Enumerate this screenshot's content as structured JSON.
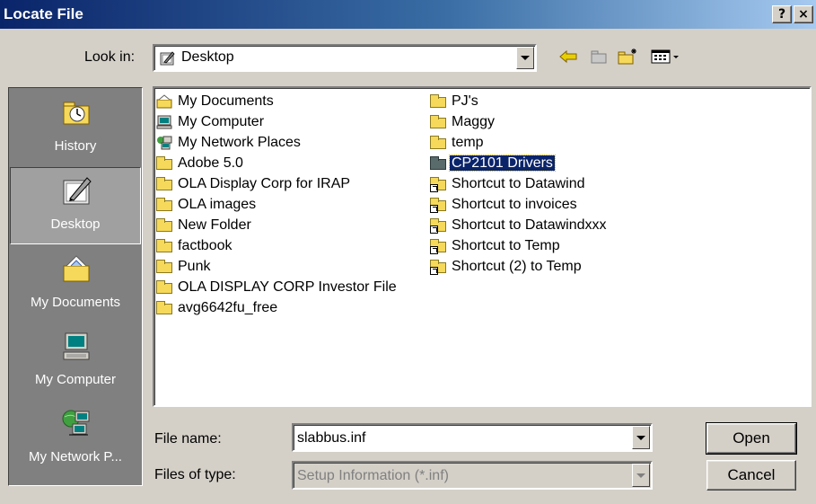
{
  "window": {
    "title": "Locate File",
    "help_button": "?",
    "close_button": "×"
  },
  "lookin": {
    "label": "Look in:",
    "value": "Desktop"
  },
  "places": [
    {
      "label": "History",
      "icon": "history-icon"
    },
    {
      "label": "Desktop",
      "icon": "desktop-icon",
      "selected": true
    },
    {
      "label": "My Documents",
      "icon": "my-documents-icon"
    },
    {
      "label": "My Computer",
      "icon": "my-computer-icon"
    },
    {
      "label": "My Network P...",
      "icon": "my-network-places-icon"
    }
  ],
  "files_left": [
    {
      "name": "My Documents",
      "icon": "my-documents-icon"
    },
    {
      "name": "My Computer",
      "icon": "my-computer-icon"
    },
    {
      "name": "My Network Places",
      "icon": "network-places-icon"
    },
    {
      "name": "Adobe 5.0",
      "icon": "folder-icon"
    },
    {
      "name": "OLA Display Corp for IRAP",
      "icon": "folder-icon"
    },
    {
      "name": "OLA images",
      "icon": "folder-icon"
    },
    {
      "name": "New Folder",
      "icon": "folder-icon"
    },
    {
      "name": "factbook",
      "icon": "folder-icon"
    },
    {
      "name": "Punk",
      "icon": "folder-icon"
    },
    {
      "name": "OLA DISPLAY CORP Investor File",
      "icon": "folder-icon"
    },
    {
      "name": "avg6642fu_free",
      "icon": "folder-icon"
    }
  ],
  "files_right": [
    {
      "name": "PJ's",
      "icon": "folder-icon"
    },
    {
      "name": "Maggy",
      "icon": "folder-icon"
    },
    {
      "name": "temp",
      "icon": "folder-icon"
    },
    {
      "name": "CP2101 Drivers",
      "icon": "folder-icon",
      "selected": true
    },
    {
      "name": "Shortcut to Datawind",
      "icon": "shortcut-folder-icon"
    },
    {
      "name": "Shortcut to invoices",
      "icon": "shortcut-folder-icon"
    },
    {
      "name": "Shortcut to Datawindxxx",
      "icon": "shortcut-folder-icon"
    },
    {
      "name": "Shortcut to Temp",
      "icon": "shortcut-folder-icon"
    },
    {
      "name": "Shortcut (2) to Temp",
      "icon": "shortcut-folder-icon"
    }
  ],
  "filename": {
    "label": "File name:",
    "value": "slabbus.inf"
  },
  "filetype": {
    "label": "Files of type:",
    "value": "Setup Information (*.inf)"
  },
  "buttons": {
    "open": "Open",
    "cancel": "Cancel"
  },
  "colors": {
    "titlebar_start": "#0a246a",
    "titlebar_end": "#a6caf0",
    "face": "#d4d0c8",
    "selection": "#0a246a"
  }
}
